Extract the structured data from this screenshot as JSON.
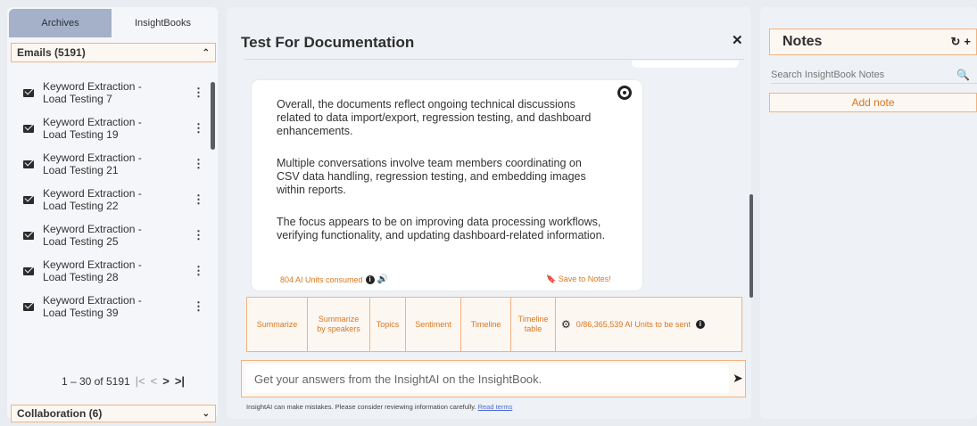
{
  "left_panel": {
    "tabs": [
      "Archives",
      "InsightBooks"
    ],
    "emails_section": "Emails (5191)",
    "collab_section": "Collaboration (6)",
    "items": [
      {
        "label": "Keyword Extraction - Load Testing 7"
      },
      {
        "label": "Keyword Extraction - Load Testing 19"
      },
      {
        "label": "Keyword Extraction - Load Testing 21"
      },
      {
        "label": "Keyword Extraction - Load Testing 22"
      },
      {
        "label": "Keyword Extraction - Load Testing 25"
      },
      {
        "label": "Keyword Extraction - Load Testing 28"
      },
      {
        "label": "Keyword Extraction - Load Testing 39"
      }
    ],
    "pager_text": "1 – 30 of 5191"
  },
  "chat": {
    "title": "Test For Documentation",
    "message": {
      "p1": "Overall, the documents reflect ongoing technical discussions related to data import/export, regression testing, and dashboard enhancements.",
      "p2": "Multiple conversations involve team members coordinating on CSV data handling, regression testing, and embedding images within reports.",
      "p3": "The focus appears to be on improving data processing workflows, verifying functionality, and updating dashboard-related information."
    },
    "units_consumed": "804 AI Units consumed",
    "save_to_notes": "Save to Notes!",
    "actions": [
      "Summarize",
      "Summarize by speakers",
      "Topics",
      "Sentiment",
      "Timeline",
      "Timeline table"
    ],
    "units_to_send": "0/86,365,539 AI Units to be sent",
    "input_placeholder": "Get your answers from the InsightAI on the InsightBook.",
    "disclaimer": "InsightAI can make mistakes. Please consider reviewing information carefully.",
    "disclaimer_link": "Read terms"
  },
  "notes": {
    "title": "Notes",
    "search_placeholder": "Search InsightBook Notes",
    "add_note": "Add note"
  },
  "colors": {
    "accent": "#d9771f",
    "border_accent": "#f3b27f",
    "tab_active": "#a5b1c9"
  }
}
